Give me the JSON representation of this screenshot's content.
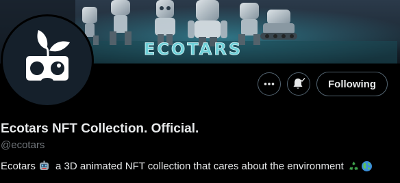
{
  "banner": {
    "title_art": "ECOTARS"
  },
  "profile": {
    "display_name": "Ecotars NFT Collection. Official.",
    "handle": "@ecotars",
    "bio_part1": "Ecotars",
    "bio_part2": " a 3D animated NFT collection that cares about the environment "
  },
  "actions": {
    "more_icon": "more-horizontal-icon",
    "notify_icon": "bell-check-icon",
    "follow_label": "Following"
  },
  "colors": {
    "background": "#000000",
    "text_primary": "#e7e9ea",
    "text_secondary": "#71767b",
    "button_border": "#536471",
    "avatar_bg": "#15202b"
  }
}
